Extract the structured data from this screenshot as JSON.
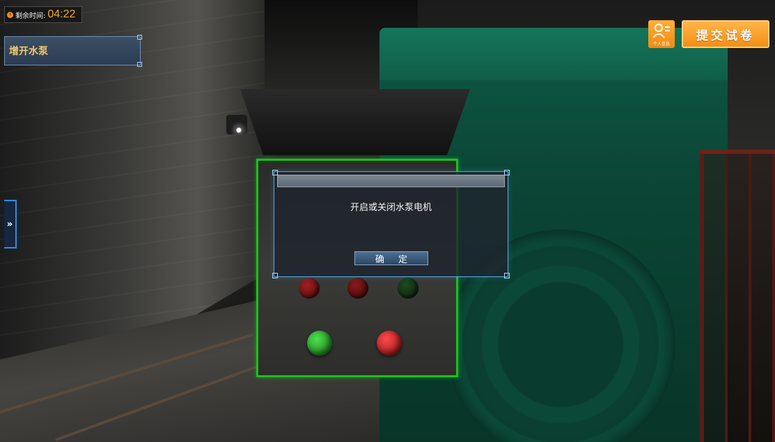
{
  "hud": {
    "timer_label": "剩余时间:",
    "timer_value": "04:22",
    "task_title": "增开水泵",
    "side_toggle": "»",
    "profile_label": "个人信息",
    "submit_label": "提交试卷"
  },
  "dialog": {
    "title": "",
    "message": "开启或关闭水泵电机",
    "confirm_label": "确 定"
  },
  "icons": {
    "clock": "clock-icon",
    "person": "user-profile-icon",
    "expand": "double-chevron-right-icon"
  },
  "colors": {
    "accent_orange": "#f5a623",
    "highlight_green": "#19c11a",
    "dialog_border": "#5ba8d8",
    "task_text": "#f6c86a"
  }
}
